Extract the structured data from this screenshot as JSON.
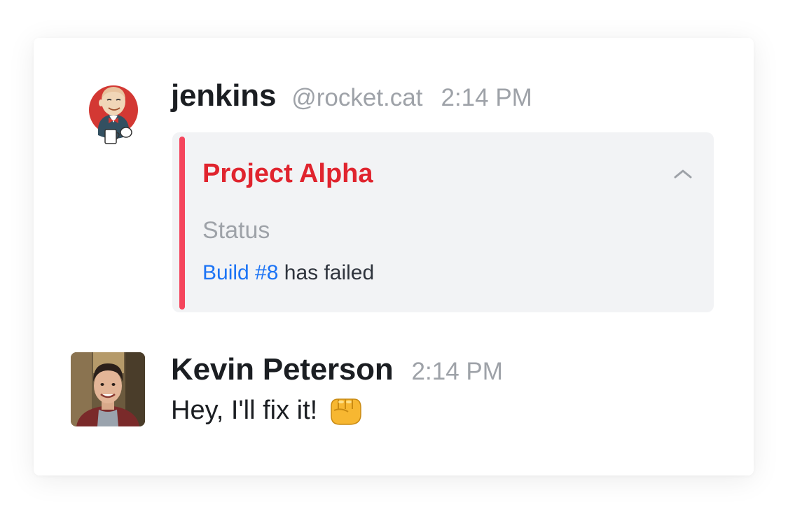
{
  "messages": [
    {
      "username": "jenkins",
      "handle": "@rocket.cat",
      "time": "2:14 PM",
      "avatar_icon": "jenkins-butler-avatar",
      "attachment": {
        "title": "Project Alpha",
        "title_color": "#e0242e",
        "accent_color": "#f5455c",
        "toggle_icon": "chevron-up-icon",
        "field_label": "Status",
        "link_text": "Build #8",
        "value_text": " has failed"
      }
    },
    {
      "username": "Kevin Peterson",
      "time": "2:14 PM",
      "avatar_icon": "user-photo-avatar",
      "text": "Hey, I'll fix it!",
      "emoji": "oncoming-fist-emoji"
    }
  ],
  "colors": {
    "link": "#1d74f5",
    "muted": "#9ea2a8",
    "text": "#1b1e22"
  }
}
